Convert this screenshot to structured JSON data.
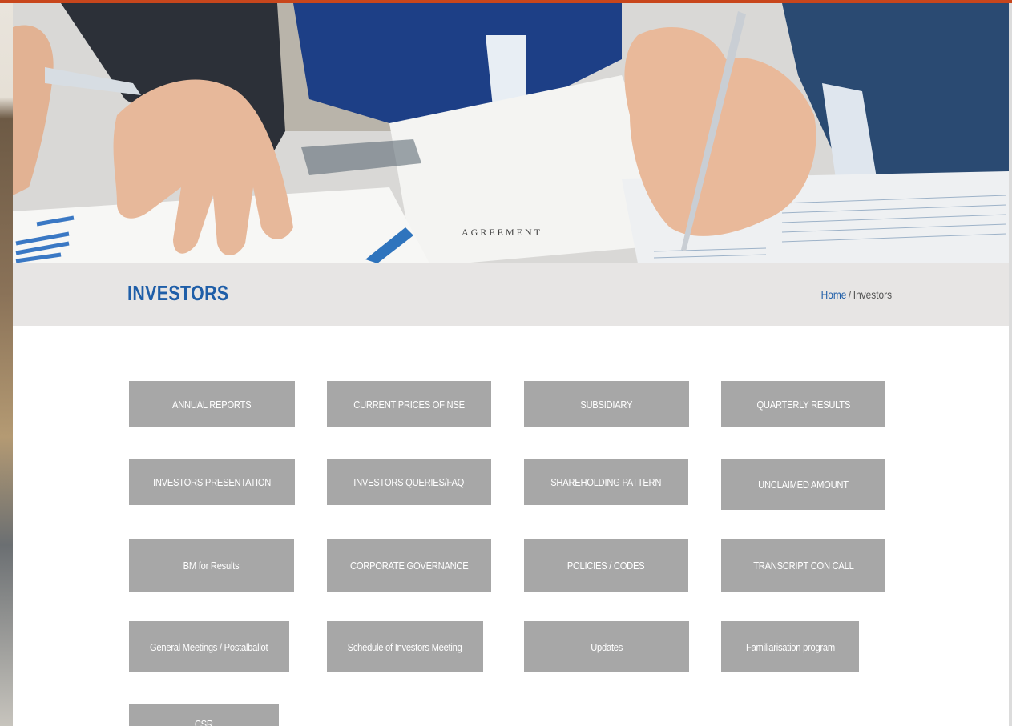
{
  "header": {
    "title": "INVESTORS",
    "breadcrumb": {
      "home": "Home",
      "separator": "/",
      "current": "Investors"
    }
  },
  "tiles": [
    "ANNUAL REPORTS",
    "CURRENT PRICES OF NSE",
    "SUBSIDIARY",
    "QUARTERLY RESULTS",
    "INVESTORS PRESENTATION",
    "INVESTORS QUERIES/FAQ",
    "SHAREHOLDING PATTERN",
    "UNCLAIMED AMOUNT",
    "BM for Results",
    "CORPORATE GOVERNANCE",
    "POLICIES / CODES",
    "TRANSCRIPT CON CALL",
    "General Meetings / Postalballot",
    "Schedule of Investors Meeting",
    "Updates",
    "Familiarisation program",
    "CSR"
  ],
  "colors": {
    "accent": "#c8461c",
    "title": "#1f5ea8",
    "tile_bg": "#a7a7a7",
    "title_bar_bg": "#e7e5e4"
  }
}
